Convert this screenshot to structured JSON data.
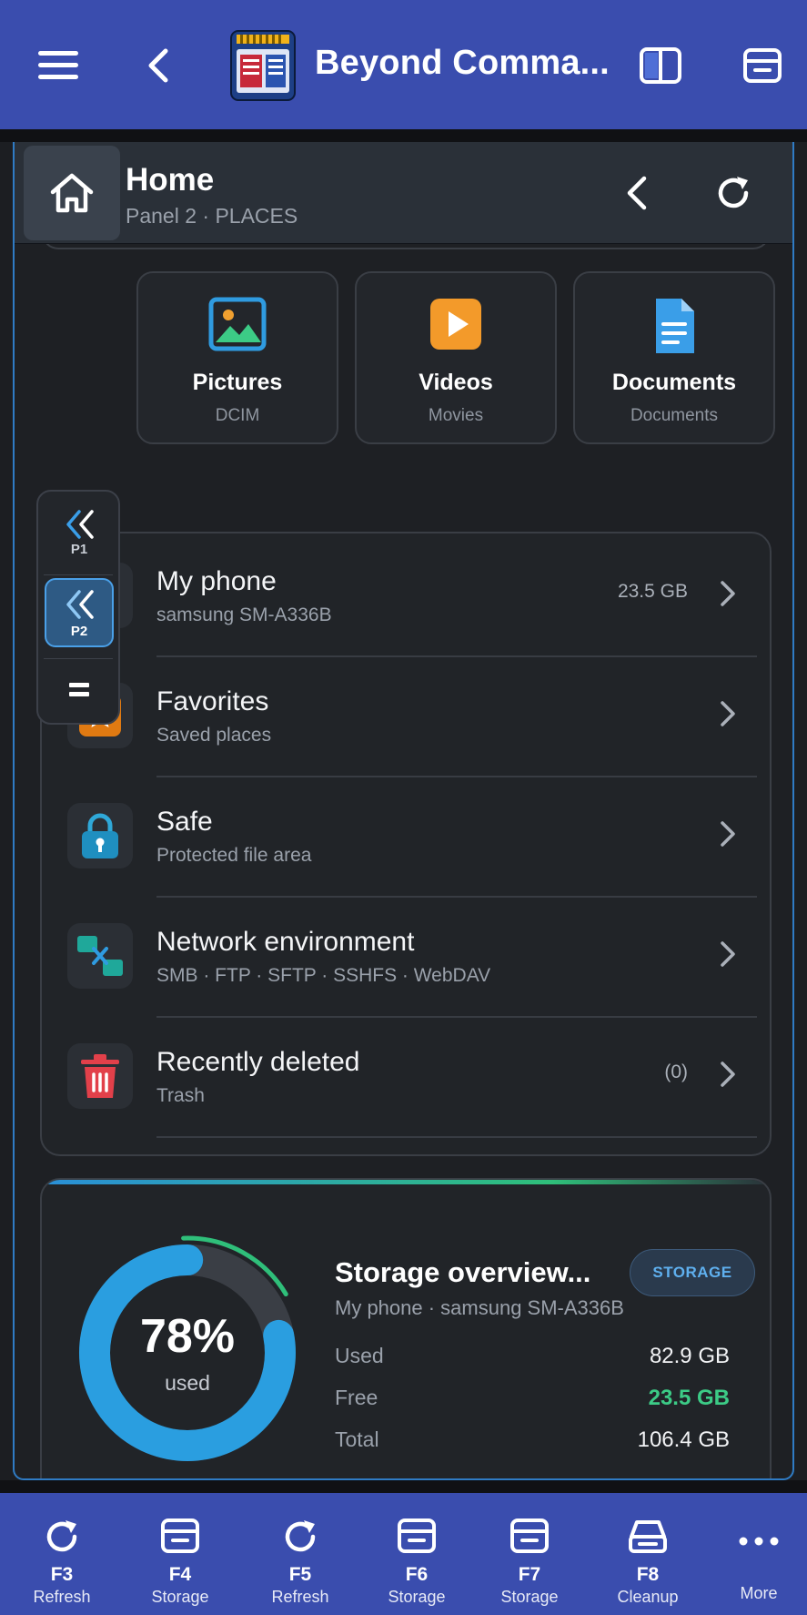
{
  "app": {
    "title": "Beyond Comma...",
    "brand_color": "#3a4dae",
    "accent_color": "#2f9be0"
  },
  "breadcrumb": {
    "title": "Home",
    "subtitle": "Panel 2 · PLACES"
  },
  "tiles": [
    {
      "name": "Pictures",
      "sub": "DCIM",
      "icon": "image-icon"
    },
    {
      "name": "Videos",
      "sub": "Movies",
      "icon": "play-icon"
    },
    {
      "name": "Documents",
      "sub": "Documents",
      "icon": "document-icon"
    }
  ],
  "switcher": {
    "p1": "P1",
    "p2": "P2",
    "active": "P2"
  },
  "places": [
    {
      "name": "My phone",
      "sub": "samsung SM-A336B",
      "value": "23.5 GB",
      "icon": "phone-icon"
    },
    {
      "name": "Favorites",
      "sub": "Saved places",
      "value": "",
      "icon": "star-icon"
    },
    {
      "name": "Safe",
      "sub": "Protected file area",
      "value": "",
      "icon": "lock-icon"
    },
    {
      "name": "Network environment",
      "sub": "SMB · FTP · SFTP · SSHFS · WebDAV",
      "value": "",
      "icon": "network-icon"
    },
    {
      "name": "Recently deleted",
      "sub": "Trash",
      "value": "(0)",
      "icon": "trash-icon"
    }
  ],
  "storage": {
    "title": "Storage overview...",
    "subtitle": "My phone · samsung SM-A336B",
    "badge": "STORAGE",
    "percent_used": 78,
    "percent_label": "78%",
    "used_caption": "used",
    "rows": [
      {
        "key": "Used",
        "value": "82.9 GB"
      },
      {
        "key": "Free",
        "value": "23.5 GB"
      },
      {
        "key": "Total",
        "value": "106.4 GB"
      }
    ],
    "free_color": "#3ccb86"
  },
  "fkeys": [
    {
      "key": "F3",
      "label": "Refresh",
      "icon": "refresh-icon"
    },
    {
      "key": "F4",
      "label": "Storage",
      "icon": "storage-icon"
    },
    {
      "key": "F5",
      "label": "Refresh",
      "icon": "refresh-icon"
    },
    {
      "key": "F6",
      "label": "Storage",
      "icon": "storage-icon"
    },
    {
      "key": "F7",
      "label": "Storage",
      "icon": "storage-icon"
    },
    {
      "key": "F8",
      "label": "Cleanup",
      "icon": "cleanup-icon"
    },
    {
      "key": "",
      "label": "More",
      "icon": "more-icon"
    }
  ]
}
